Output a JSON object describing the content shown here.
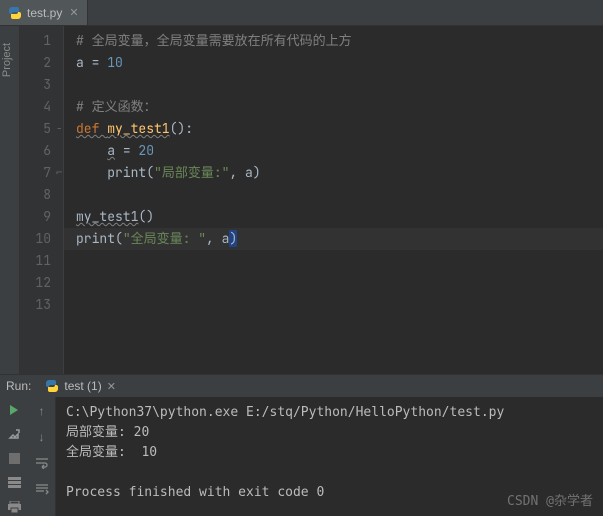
{
  "tab": {
    "filename": "test.py"
  },
  "sidebar": {
    "project_label": "Project"
  },
  "gutter": {
    "lines": [
      "1",
      "2",
      "3",
      "4",
      "5",
      "6",
      "7",
      "8",
      "9",
      "10",
      "11",
      "12",
      "13"
    ]
  },
  "code": {
    "l1_comment": "# 全局变量，全局变量需要放在所有代码的上方",
    "l2_a": "a",
    "l2_eq": " = ",
    "l2_val": "10",
    "l4_comment": "# 定义函数：",
    "l5_def": "def ",
    "l5_name": "my_test1",
    "l5_paren": "():",
    "l6_a": "a",
    "l6_eq": " = ",
    "l6_val": "20",
    "l7_print": "print",
    "l7_lp": "(",
    "l7_str": "\"局部变量:\"",
    "l7_comma": ", ",
    "l7_arg": "a",
    "l7_rp": ")",
    "l9_call": "my_test1",
    "l9_paren": "()",
    "l10_print": "print",
    "l10_lp": "(",
    "l10_str": "\"全局变量: \"",
    "l10_comma": ", ",
    "l10_arg": "a",
    "l10_rp": ")"
  },
  "run": {
    "label": "Run:",
    "config": "test (1)"
  },
  "console": {
    "cmd": "C:\\Python37\\python.exe E:/stq/Python/HelloPython/test.py",
    "out1": "局部变量: 20",
    "out2": "全局变量:  10",
    "exit": "Process finished with exit code 0"
  },
  "watermark": "CSDN @杂学者"
}
